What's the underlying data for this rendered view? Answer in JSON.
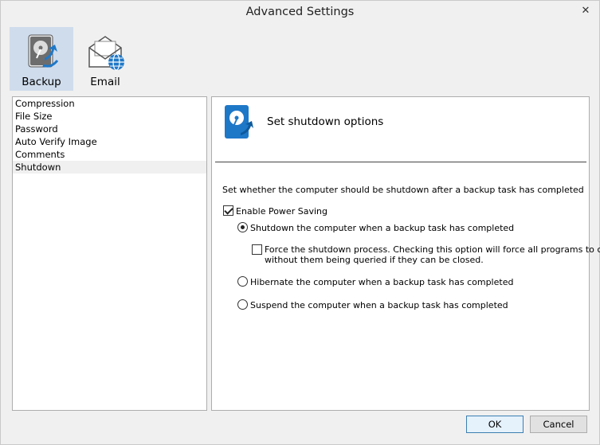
{
  "window": {
    "title": "Advanced Settings",
    "close_glyph": "✕"
  },
  "toolbar": {
    "items": [
      {
        "label": "Backup",
        "icon": "backup-drive-icon",
        "selected": true
      },
      {
        "label": "Email",
        "icon": "email-globe-icon",
        "selected": false
      }
    ]
  },
  "sidebar": {
    "items": [
      {
        "label": "Compression"
      },
      {
        "label": "File Size"
      },
      {
        "label": "Password"
      },
      {
        "label": "Auto Verify Image"
      },
      {
        "label": "Comments"
      },
      {
        "label": "Shutdown",
        "active": true
      }
    ]
  },
  "panel": {
    "icon": "shutdown-drive-icon",
    "title": "Set shutdown options",
    "description": "Set whether the computer should be shutdown after a backup task has completed",
    "enable_power_saving": {
      "label": "Enable Power Saving",
      "checked": true
    },
    "options": {
      "shutdown": {
        "label": "Shutdown the computer when a backup task has completed",
        "checked": true
      },
      "force_line1": "Force the shutdown process.  Checking this option will force all programs to close",
      "force_line2": "without them being queried if they can be closed.",
      "force_checked": false,
      "hibernate": {
        "label": "Hibernate the computer when a backup task has completed",
        "checked": false
      },
      "suspend": {
        "label": "Suspend the computer when a backup task has completed",
        "checked": false
      }
    }
  },
  "buttons": {
    "ok": "OK",
    "cancel": "Cancel"
  },
  "colors": {
    "accent": "#1e78c8",
    "selected_tab": "#cfdcec",
    "default_button_border": "#3c7fb1"
  }
}
